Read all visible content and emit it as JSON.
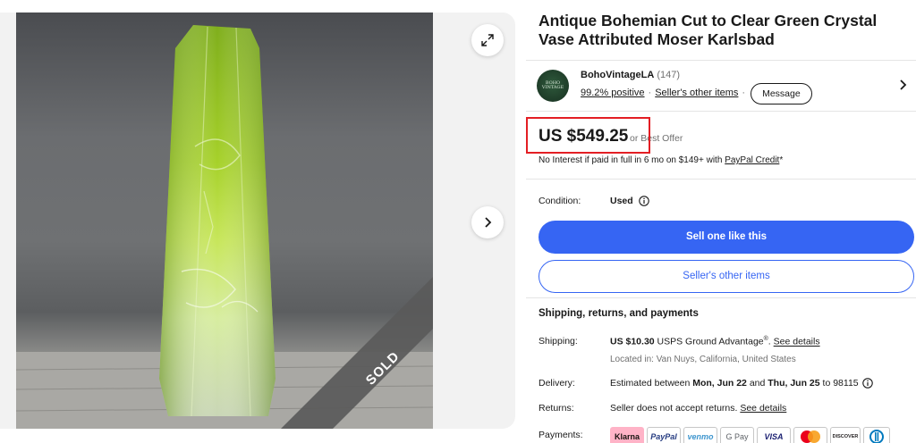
{
  "listing": {
    "title": "Antique Bohemian Cut to Clear Green Crystal Vase Attributed Moser Karlsbad",
    "sold_banner": "SOLD"
  },
  "seller": {
    "avatar_text": "BOHO VINTAGE",
    "name": "BohoVintageLA",
    "feedback_count": "(147)",
    "positive": "99.2% positive",
    "separator": "·",
    "other_items_link": "Seller's other items",
    "message_button": "Message"
  },
  "price": {
    "amount": "US $549.25",
    "best_offer": "or Best Offer",
    "financing_text": "No Interest if paid in full in 6 mo on $149+ with ",
    "financing_link": "PayPal Credit",
    "financing_suffix": "*"
  },
  "condition": {
    "label": "Condition:",
    "value": "Used"
  },
  "actions": {
    "sell_one_like_this": "Sell one like this",
    "sellers_other_items": "Seller's other items"
  },
  "shipping": {
    "heading": "Shipping, returns, and payments",
    "shipping_label": "Shipping:",
    "shipping_price": "US $10.30",
    "shipping_service": " USPS Ground Advantage",
    "registered": "®",
    "shipping_sep": ". ",
    "see_details": "See details",
    "location": "Located in: Van Nuys, California, United States",
    "delivery_label": "Delivery:",
    "delivery_prefix": "Estimated between ",
    "delivery_start": "Mon, Jun 22",
    "delivery_and": " and ",
    "delivery_end": "Thu, Jun 25",
    "delivery_suffix": " to 98115",
    "returns_label": "Returns:",
    "returns_text": "Seller does not accept returns. ",
    "returns_link": "See details",
    "payments_label": "Payments:",
    "payment_methods": [
      "Klarna",
      "PayPal",
      "venmo",
      "G Pay",
      "VISA",
      "Mastercard",
      "DISCOVER",
      "Diners Club"
    ]
  },
  "colors": {
    "primary": "#3665f3",
    "highlight_box": "#e31e24",
    "klarna": "#ffb3c7",
    "paypal": "#253b80",
    "venmo": "#3d95ce",
    "visa": "#1a1f71"
  }
}
